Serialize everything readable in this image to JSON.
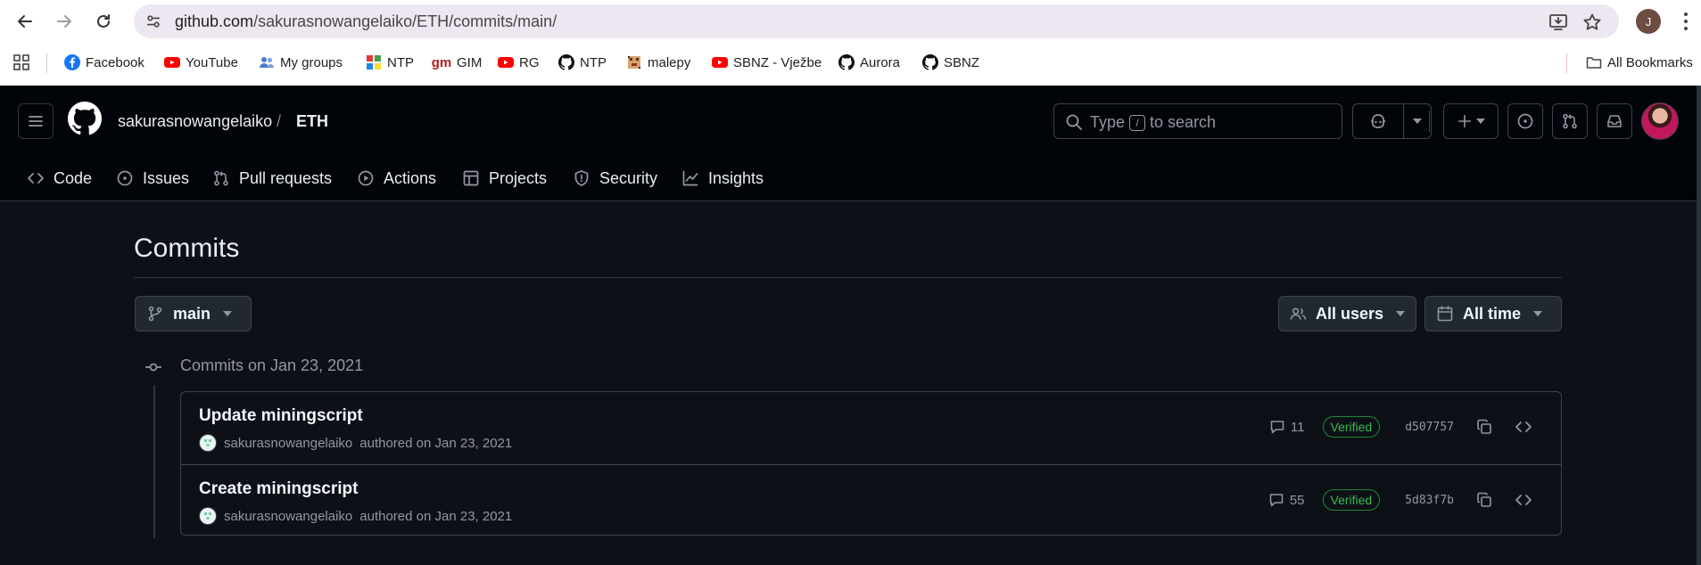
{
  "browser": {
    "url_host": "github.com",
    "url_path": "/sakurasnowangelaiko/ETH/commits/main/",
    "profile_initial": "J",
    "bookmarks": [
      {
        "label": "Facebook",
        "icon": "facebook-icon",
        "color": "#1877f2"
      },
      {
        "label": "YouTube",
        "icon": "youtube-icon",
        "color": "#ff0000"
      },
      {
        "label": "My groups",
        "icon": "groups-icon",
        "color": "#4a7bd1"
      },
      {
        "label": "NTP",
        "icon": "puzzle-icon",
        "color": "#e53935"
      },
      {
        "label": "GIM",
        "icon": "gm-icon",
        "color": "#b71c1c"
      },
      {
        "label": "RG",
        "icon": "youtube-icon",
        "color": "#ff0000"
      },
      {
        "label": "NTP",
        "icon": "github-icon",
        "color": "#111111"
      },
      {
        "label": "malepy",
        "icon": "pixel-icon",
        "color": "#8d3b1f"
      },
      {
        "label": "SBNZ - Vježbe",
        "icon": "youtube-icon",
        "color": "#ff0000"
      },
      {
        "label": "Aurora",
        "icon": "github-icon",
        "color": "#111111"
      },
      {
        "label": "SBNZ",
        "icon": "github-icon",
        "color": "#111111"
      }
    ],
    "all_bookmarks": "All Bookmarks"
  },
  "header": {
    "owner": "sakurasnowangelaiko",
    "separator": "/",
    "repo": "ETH",
    "search_prefix": "Type",
    "search_key": "/",
    "search_suffix": "to search"
  },
  "repo_nav": [
    {
      "label": "Code",
      "icon": "code-icon"
    },
    {
      "label": "Issues",
      "icon": "issue-icon"
    },
    {
      "label": "Pull requests",
      "icon": "pull-request-icon"
    },
    {
      "label": "Actions",
      "icon": "play-icon"
    },
    {
      "label": "Projects",
      "icon": "table-icon"
    },
    {
      "label": "Security",
      "icon": "shield-icon"
    },
    {
      "label": "Insights",
      "icon": "graph-icon"
    }
  ],
  "main": {
    "title": "Commits",
    "branch": "main",
    "users_filter": "All users",
    "time_filter": "All time",
    "group_label": "Commits on Jan 23, 2021",
    "commits": [
      {
        "title": "Update miningscript",
        "author": "sakurasnowangelaiko",
        "authored": "authored on Jan 23, 2021",
        "comments": "11",
        "badge": "Verified",
        "sha": "d507757"
      },
      {
        "title": "Create miningscript",
        "author": "sakurasnowangelaiko",
        "authored": "authored on Jan 23, 2021",
        "comments": "55",
        "badge": "Verified",
        "sha": "5d83f7b"
      }
    ]
  },
  "colors": {
    "page_bg": "#0d1117",
    "header_bg": "#010409",
    "verified_green": "#3fb950",
    "border": "#3d444d"
  }
}
